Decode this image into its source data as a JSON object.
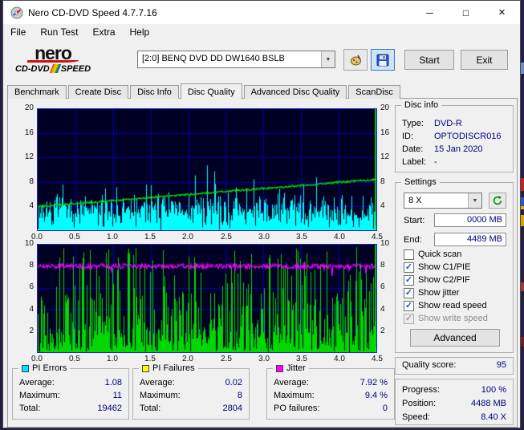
{
  "window": {
    "title": "Nero CD-DVD Speed 4.7.7.16"
  },
  "icons": {
    "minimize": "─",
    "maximize": "□",
    "close": "×",
    "dropdown": "▼"
  },
  "menu": {
    "items": [
      {
        "label": "File"
      },
      {
        "label": "Run Test"
      },
      {
        "label": "Extra"
      },
      {
        "label": "Help"
      }
    ]
  },
  "logo": {
    "brand": "nero",
    "product_left": "CD-DVD",
    "product_right": "SPEED"
  },
  "toolbar": {
    "drive_selector": "[2:0]  BENQ  DVD  DD DW1640 BSLB",
    "start_button": "Start",
    "exit_button": "Exit"
  },
  "tabs": [
    {
      "label": "Benchmark",
      "active": false
    },
    {
      "label": "Create Disc",
      "active": false
    },
    {
      "label": "Disc Info",
      "active": false
    },
    {
      "label": "Disc Quality",
      "active": true
    },
    {
      "label": "Advanced Disc Quality",
      "active": false
    },
    {
      "label": "ScanDisc",
      "active": false
    }
  ],
  "disc_info": {
    "title": "Disc info",
    "rows": [
      {
        "label": "Type:",
        "value": "DVD-R"
      },
      {
        "label": "ID:",
        "value": "OPTODISCR016"
      },
      {
        "label": "Date:",
        "value": "15 Jan 2020"
      },
      {
        "label": "Label:",
        "value": "-"
      }
    ]
  },
  "settings": {
    "title": "Settings",
    "speed": "8 X",
    "start_label": "Start:",
    "start_value": "0000 MB",
    "end_label": "End:",
    "end_value": "4489 MB",
    "checkboxes": [
      {
        "label": "Quick scan",
        "checked": false,
        "disabled": false
      },
      {
        "label": "Show C1/PIE",
        "checked": true,
        "disabled": false
      },
      {
        "label": "Show C2/PIF",
        "checked": true,
        "disabled": false
      },
      {
        "label": "Show jitter",
        "checked": true,
        "disabled": false
      },
      {
        "label": "Show read speed",
        "checked": true,
        "disabled": false
      },
      {
        "label": "Show write speed",
        "checked": true,
        "disabled": true
      }
    ],
    "advanced_button": "Advanced"
  },
  "quality": {
    "label": "Quality score:",
    "value": "95"
  },
  "progress": {
    "rows": [
      {
        "label": "Progress:",
        "value": "100 %"
      },
      {
        "label": "Position:",
        "value": "4488 MB"
      },
      {
        "label": "Speed:",
        "value": "8.40 X"
      }
    ]
  },
  "stats": {
    "pi_errors": {
      "title": "PI Errors",
      "color": "#00e5ff",
      "rows": [
        {
          "label": "Average:",
          "value": "1.08"
        },
        {
          "label": "Maximum:",
          "value": "11"
        },
        {
          "label": "Total:",
          "value": "19462"
        }
      ]
    },
    "pi_failures": {
      "title": "PI Failures",
      "color": "#ffff00",
      "rows": [
        {
          "label": "Average:",
          "value": "0.02"
        },
        {
          "label": "Maximum:",
          "value": "8"
        },
        {
          "label": "Total:",
          "value": "2804"
        }
      ]
    },
    "jitter": {
      "title": "Jitter",
      "color": "#ff00ff",
      "rows": [
        {
          "label": "Average:",
          "value": "7.92 %"
        },
        {
          "label": "Maximum:",
          "value": "9.4 %"
        },
        {
          "label": "PO failures:",
          "value": "0"
        }
      ]
    }
  },
  "chart_data": [
    {
      "type": "area",
      "name": "PI Errors vs Read speed",
      "seed": 7,
      "x_ticks": [
        "0.0",
        "0.5",
        "1.0",
        "1.5",
        "2.0",
        "2.5",
        "3.0",
        "3.5",
        "4.0",
        "4.5"
      ],
      "y_ticks": [
        "20",
        "16",
        "12",
        "8",
        "4"
      ],
      "y_max": 20,
      "grid": true,
      "cursor": "#00ff00",
      "series": [
        {
          "name": "pi-errors",
          "kind": "noise-area",
          "color": "#00ffff",
          "base": 2.6,
          "noise": 3.6,
          "spike_chance": 0.09,
          "spike_extra": 5.0,
          "max": 11
        },
        {
          "name": "read-speed",
          "kind": "trend-line",
          "color": "#00e000",
          "start": 3.9,
          "end": 8.4,
          "jitter": 0.3
        }
      ]
    },
    {
      "type": "bars",
      "name": "PI Failures vs Jitter",
      "seed": 13,
      "x_ticks": [
        "0.0",
        "0.5",
        "1.0",
        "1.5",
        "2.0",
        "2.5",
        "3.0",
        "3.5",
        "4.0",
        "4.5"
      ],
      "y_ticks": [
        "10",
        "8",
        "6",
        "4",
        "2"
      ],
      "y_max": 10,
      "grid": true,
      "cursor": "#00ff00",
      "series": [
        {
          "name": "pi-failures",
          "kind": "noise-bars",
          "color": "#00d800",
          "quiet": 2.4,
          "mid": 5.6,
          "tall": 9.8,
          "p_quiet": 0.52,
          "p_mid": 0.28
        },
        {
          "name": "jitter",
          "kind": "flat-line",
          "color": "#ff00ff",
          "level": 8.0,
          "jitter": 0.45
        }
      ]
    }
  ]
}
